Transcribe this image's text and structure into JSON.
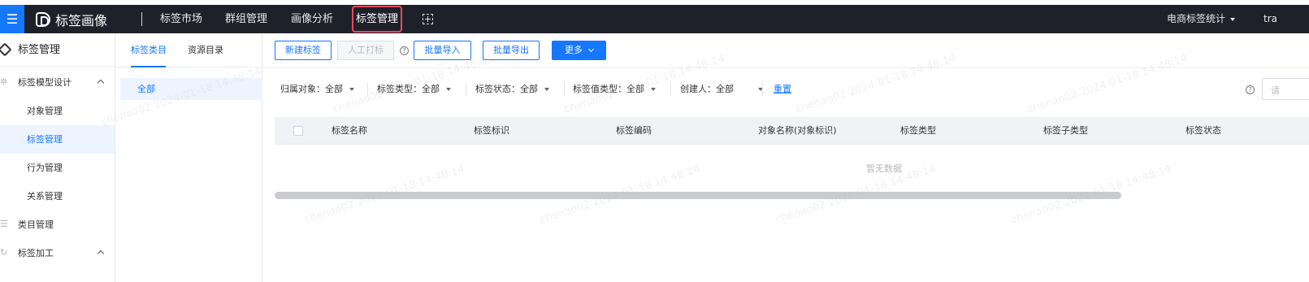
{
  "topbar": {
    "menu_icon": "menu-icon",
    "app_name": "标签画像",
    "nav": [
      "标签市场",
      "群组管理",
      "画像分析",
      "标签管理"
    ],
    "active_nav": "标签管理",
    "right_dropdown": "电商标签统计",
    "user": "tra"
  },
  "sidebar": {
    "title": "标签管理",
    "groups": [
      {
        "label": "标签模型设计",
        "items": [
          "对象管理",
          "标签管理",
          "行为管理",
          "关系管理"
        ]
      },
      {
        "label": "类目管理"
      },
      {
        "label": "标签加工"
      }
    ],
    "active_item": "标签管理"
  },
  "category_panel": {
    "tabs": [
      "标签类目",
      "资源目录"
    ],
    "active_tab": "标签类目",
    "items": [
      "全部"
    ]
  },
  "toolbar": {
    "new_tag": "新建标签",
    "manual_tag": "人工打标",
    "batch_import": "批量导入",
    "batch_export": "批量导出",
    "more": "更多"
  },
  "filters": [
    {
      "label": "归属对象：",
      "value": "全部"
    },
    {
      "label": "标签类型：",
      "value": "全部"
    },
    {
      "label": "标签状态：",
      "value": "全部"
    },
    {
      "label": "标签值类型：",
      "value": "全部"
    },
    {
      "label": "创建人：",
      "value": "全部"
    }
  ],
  "reset_label": "重置",
  "search_placeholder": "请",
  "table": {
    "columns": [
      "标签名称",
      "标签标识",
      "标签编码",
      "对象名称(对象标识)",
      "标签类型",
      "标签子类型",
      "标签状态"
    ],
    "empty_text": "暂无数据"
  },
  "watermark_text": "chenao02 2024-01-18 14:48:14",
  "colors": {
    "primary": "#1677ff",
    "topbar_bg": "#1e2129",
    "highlight_border": "#e84a5f"
  }
}
